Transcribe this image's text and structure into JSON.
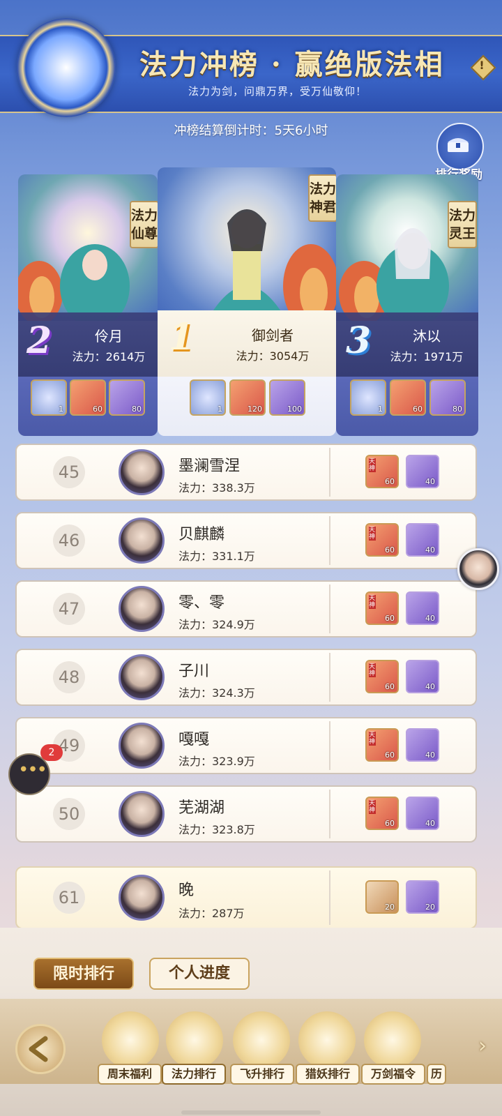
{
  "header": {
    "title": "法力冲榜 · 赢绝版法相",
    "subtitle": "法力为剑，问鼎万界，受万仙敬仰！",
    "info_icon": "!",
    "countdown": "冲榜结算倒计时：5天6小时",
    "reward_button": "排行奖励"
  },
  "podium": [
    {
      "rank": "2",
      "title": "法力仙尊",
      "name": "伶月",
      "power": "法力：2614万",
      "items": [
        {
          "icon": "ring-icon",
          "count": "1"
        },
        {
          "icon": "character-card-icon",
          "count": "60"
        },
        {
          "icon": "purple-crystal-icon",
          "count": "80"
        }
      ]
    },
    {
      "rank": "1",
      "title": "法力神君",
      "name": "御剑者",
      "power": "法力：3054万",
      "items": [
        {
          "icon": "ring-icon",
          "count": "1"
        },
        {
          "icon": "character-card-icon",
          "count": "120"
        },
        {
          "icon": "purple-crystal-icon",
          "count": "100"
        }
      ]
    },
    {
      "rank": "3",
      "title": "法力灵王",
      "name": "沐以",
      "power": "法力：1971万",
      "items": [
        {
          "icon": "ring-icon",
          "count": "1"
        },
        {
          "icon": "character-card-icon",
          "count": "60"
        },
        {
          "icon": "purple-crystal-icon",
          "count": "80"
        }
      ]
    }
  ],
  "list": [
    {
      "rank": "45",
      "name": "墨澜雪涅",
      "power": "法力：338.3万",
      "reward_a": "60",
      "reward_b": "40"
    },
    {
      "rank": "46",
      "name": "贝麒麟",
      "power": "法力：331.1万",
      "reward_a": "60",
      "reward_b": "40"
    },
    {
      "rank": "47",
      "name": "零、零",
      "power": "法力：324.9万",
      "reward_a": "60",
      "reward_b": "40"
    },
    {
      "rank": "48",
      "name": "子川",
      "power": "法力：324.3万",
      "reward_a": "60",
      "reward_b": "40"
    },
    {
      "rank": "49",
      "name": "嘎嘎",
      "power": "法力：323.9万",
      "reward_a": "60",
      "reward_b": "40"
    },
    {
      "rank": "50",
      "name": "芜湖湖",
      "power": "法力：323.8万",
      "reward_a": "60",
      "reward_b": "40"
    }
  ],
  "self_row": {
    "rank": "61",
    "name": "晚",
    "power": "法力：287万",
    "reward_a": "20",
    "reward_b": "20"
  },
  "card_tag": "天神",
  "chat": {
    "badge": "2"
  },
  "tabs": {
    "active": "限时排行",
    "inactive": "个人进度"
  },
  "nav": [
    {
      "label": "周末福利",
      "icon": "frog-icon"
    },
    {
      "label": "法力排行",
      "icon": "gate-icon"
    },
    {
      "label": "飞升排行",
      "icon": "gate-icon"
    },
    {
      "label": "猎妖排行",
      "icon": "gate-icon"
    },
    {
      "label": "万剑福令",
      "icon": "token-icon"
    },
    {
      "label": "历",
      "icon": "partial-icon"
    }
  ],
  "colors": {
    "accent_gold": "#e6c879",
    "banner_blue": "#2f56b8",
    "brown_tab": "#8a5a22"
  }
}
